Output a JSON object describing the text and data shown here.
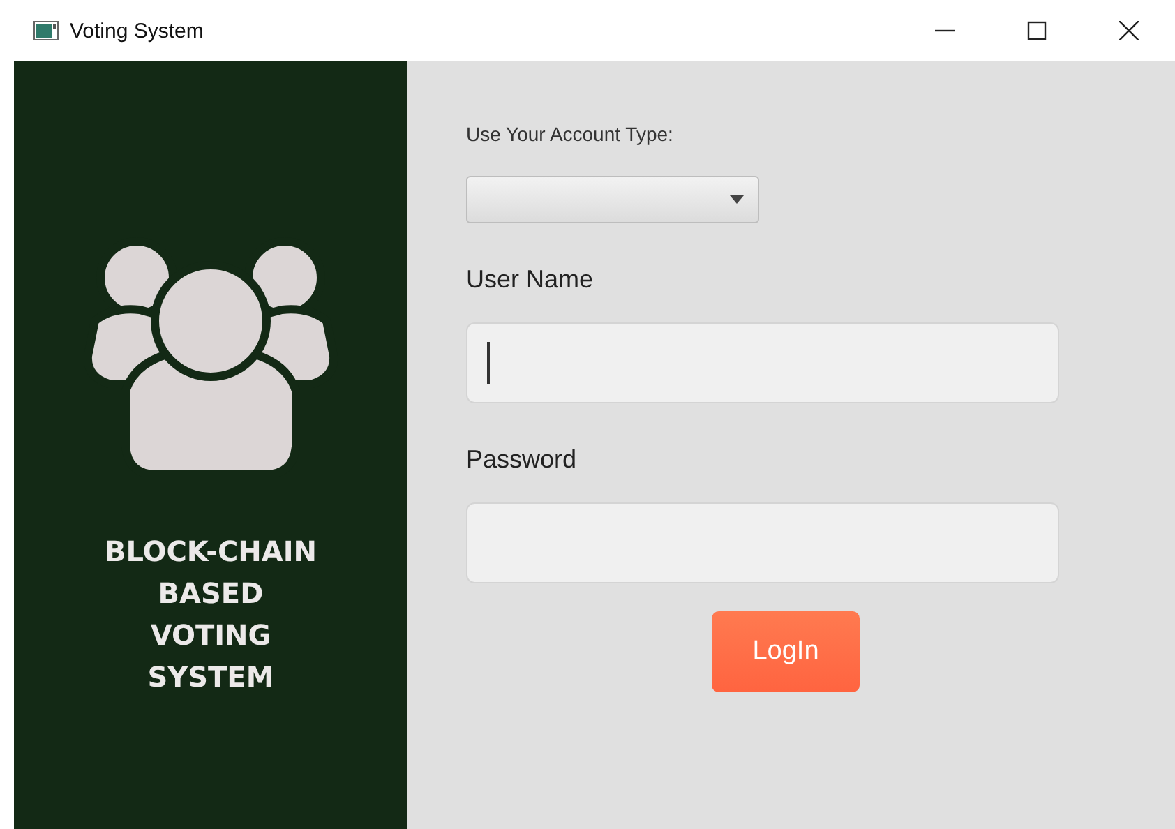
{
  "window": {
    "title": "Voting System"
  },
  "sidebar": {
    "title": "BLOCK-CHAIN\nBASED\nVOTING\nSYSTEM"
  },
  "form": {
    "account_type": {
      "label": "Use Your Account Type:"
    },
    "fields": [
      {
        "label": "User Name",
        "focused": true
      },
      {
        "label": "Password",
        "focused": false
      }
    ],
    "button": "LogIn"
  }
}
